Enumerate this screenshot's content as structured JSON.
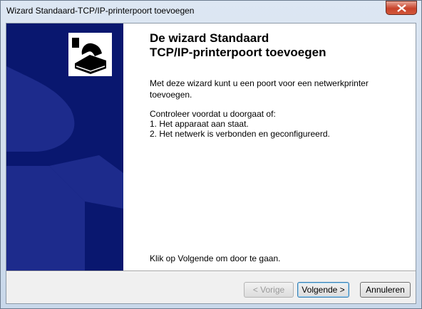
{
  "window": {
    "title": "Wizard Standaard-TCP/IP-printerpoort toevoegen"
  },
  "content": {
    "heading_line1": "De wizard Standaard",
    "heading_line2": "TCP/IP-printerpoort toevoegen",
    "intro": "Met deze wizard kunt u een poort voor een netwerkprinter toevoegen.",
    "check_title": "Controleer voordat u doorgaat of:",
    "check_items": [
      "1. Het apparaat aan staat.",
      "2. Het netwerk is verbonden en geconfigureerd."
    ],
    "footer": "Klik op Volgende om door te gaan."
  },
  "buttons": {
    "back": "< Vorige",
    "next": "Volgende >",
    "cancel": "Annuleren"
  },
  "colors": {
    "sidebar": "#09176f",
    "sidebar_accent": "#1d2b8c"
  },
  "icons": [
    "close-icon",
    "printer-icon"
  ]
}
